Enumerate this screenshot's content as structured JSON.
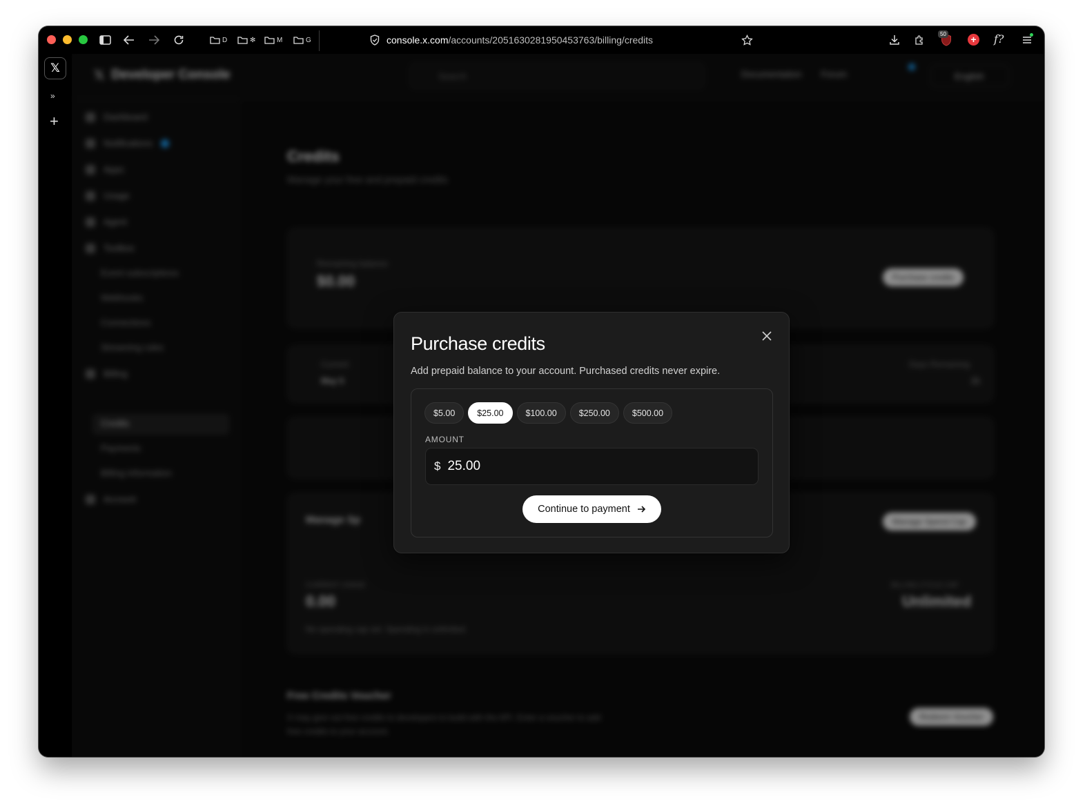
{
  "browser": {
    "bookmarks": [
      {
        "label": "D"
      },
      {
        "label": "✻"
      },
      {
        "label": "M"
      },
      {
        "label": "G"
      }
    ],
    "url_host": "console.x.com",
    "url_path": "/accounts/2051630281950453763/billing/credits",
    "extension_badge": "50",
    "extension_label": "f?"
  },
  "rail": {
    "logo": "𝕏",
    "expand": "»",
    "new": "+"
  },
  "background": {
    "brand": "Developer Console",
    "search_placeholder": "Search",
    "top_links": [
      "Documentation",
      "Forum"
    ],
    "language": "English",
    "sidebar": [
      {
        "label": "Dashboard"
      },
      {
        "label": "Notifications"
      },
      {
        "label": "Apps"
      },
      {
        "label": "Usage"
      },
      {
        "label": "Agent"
      },
      {
        "label": "Toolbox"
      },
      {
        "label": "Event subscriptions"
      },
      {
        "label": "Webhooks"
      },
      {
        "label": "Connections"
      },
      {
        "label": "Streaming rules"
      },
      {
        "label": "Billing"
      },
      {
        "label": "Credits"
      },
      {
        "label": "Payments"
      },
      {
        "label": "Billing information"
      },
      {
        "label": "Account"
      }
    ],
    "page_title": "Credits",
    "page_subtitle": "Manage your free and prepaid credits",
    "remaining_label": "Remaining balance",
    "remaining_value": "$0.00",
    "purchase_button": "Purchase credits",
    "cycle_label": "Current",
    "cycle_value": "May 5",
    "days_label": "Days Remaining",
    "days_value": "21",
    "spend_title": "Manage Sp",
    "spend_button": "Manage Spend Cap",
    "current_usage_label": "CURRENT USAGE",
    "current_usage_value": "0.00",
    "cycle_cap_label": "BILLING CYCLE CAP",
    "cycle_cap_value": "Unlimited",
    "spend_note": "No spending cap set. Spending is unlimited.",
    "voucher_title": "Free Credits Voucher",
    "voucher_desc": "X may give out free credits to developers to build with the API. Enter a voucher to add free credits to your account.",
    "voucher_button": "Redeem Voucher"
  },
  "modal": {
    "title": "Purchase credits",
    "description": "Add prepaid balance to your account. Purchased credits never expire.",
    "presets": [
      {
        "label": "$5.00",
        "selected": false
      },
      {
        "label": "$25.00",
        "selected": true
      },
      {
        "label": "$100.00",
        "selected": false
      },
      {
        "label": "$250.00",
        "selected": false
      },
      {
        "label": "$500.00",
        "selected": false
      }
    ],
    "amount_label": "AMOUNT",
    "currency_symbol": "$",
    "amount_value": "25.00",
    "continue_label": "Continue to payment",
    "continue_icon": "arrow-right-icon",
    "close_icon": "close-icon"
  },
  "colors": {
    "modal_bg": "#1c1c1c",
    "primary_button_bg": "#ffffff",
    "accent_blue": "#1d9bf0"
  }
}
